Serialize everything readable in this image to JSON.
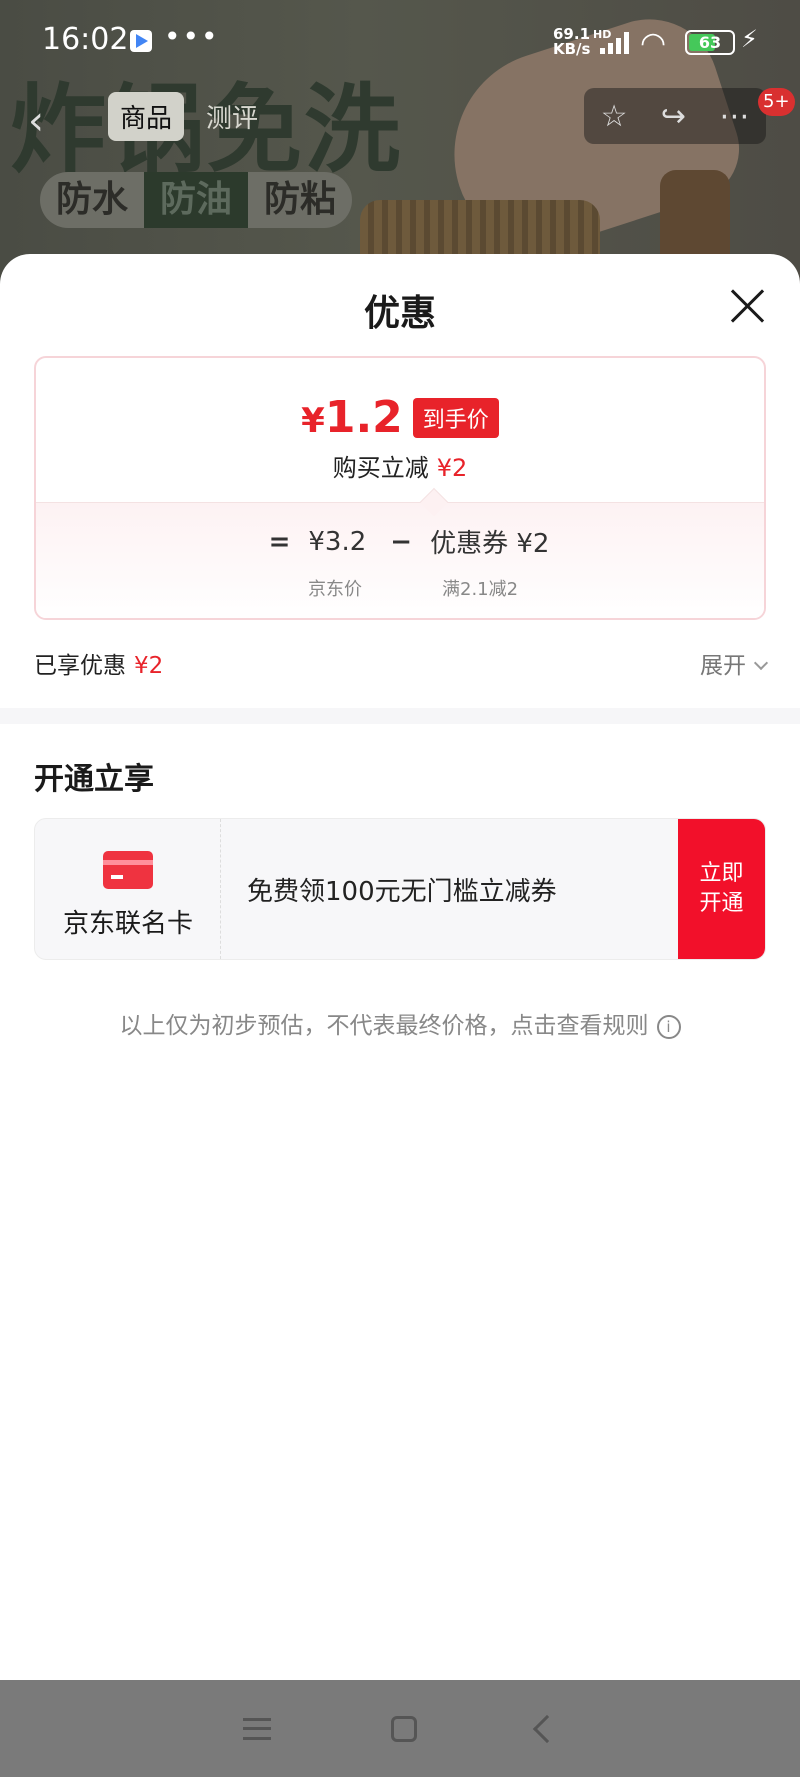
{
  "status_bar": {
    "time": "16:02",
    "speed": "69.1\nKB/s",
    "net": "HD",
    "battery": "63",
    "battery_level": 0.63
  },
  "background": {
    "banner": "炸锅免洗",
    "tags": [
      "防水",
      "防油",
      "防粘"
    ]
  },
  "top_nav": {
    "tabs": [
      {
        "label": "商品",
        "active": true
      },
      {
        "label": "测评",
        "active": false
      }
    ],
    "badge": "5+"
  },
  "sheet": {
    "title": "优惠",
    "price_card": {
      "currency": "¥",
      "final_price": "1.2",
      "final_tag": "到手价",
      "reduce_label": "购买立减",
      "reduce_value": "¥2",
      "equals": "=",
      "jd_price": "¥3.2",
      "minus": "−",
      "coupon": "优惠券 ¥2",
      "jd_price_label": "京东价",
      "coupon_rule": "满2.1减2"
    },
    "enjoyed_label": "已享优惠",
    "enjoyed_value": "¥2",
    "expand_label": "展开",
    "section_title": "开通立享",
    "card": {
      "name": "京东联名卡",
      "desc": "免费领100元无门槛立减券",
      "button": "立即开通"
    },
    "footnote": "以上仅为初步预估，不代表最终价格，点击查看规则",
    "info_glyph": "i"
  },
  "colors": {
    "accent_red": "#e8232a",
    "button_red": "#f2102a"
  }
}
